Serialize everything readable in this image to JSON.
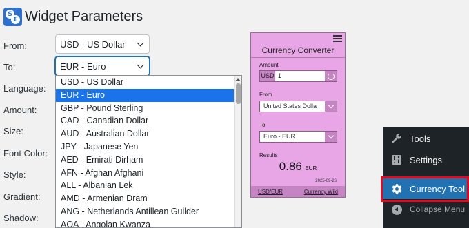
{
  "page": {
    "title": "Widget Parameters",
    "icon_glyphs": [
      "$",
      "£"
    ]
  },
  "form": {
    "labels": {
      "from": "From:",
      "to": "To:",
      "language": "Language:",
      "amount": "Amount:",
      "size": "Size:",
      "font_color": "Font Color:",
      "style": "Style:",
      "gradient": "Gradient:",
      "shadow": "Shadow:"
    },
    "from_value": "USD - US Dollar",
    "to_value": "EUR - Euro"
  },
  "dropdown": {
    "selected_index": 1,
    "options": [
      "USD - US Dollar",
      "EUR - Euro",
      "GBP - Pound Sterling",
      "CAD - Canadian Dollar",
      "AUD - Australian Dollar",
      "JPY - Japanese Yen",
      "AED - Emirati Dirham",
      "AFN - Afghan Afghani",
      "ALL - Albanian Lek",
      "AMD - Armenian Dram",
      "ANG - Netherlands Antillean Guilder",
      "AOA - Angolan Kwanza"
    ]
  },
  "widget": {
    "title": "Currency Converter",
    "amount_label": "Amount",
    "amount_code": "USD",
    "amount_value": "1",
    "from_label": "From",
    "from_value": "United States Dolla",
    "to_label": "To",
    "to_value": "Euro - EUR",
    "results_label": "Results",
    "result_value": "0.86",
    "result_currency": "EUR",
    "date": "2025-09-26",
    "footer_left": "USD/EUR",
    "footer_right": "Currency.Wiki",
    "colors": {
      "background": "#e8a6e6",
      "accent": "#c585c3"
    }
  },
  "admin_menu": {
    "tools": "Tools",
    "settings": "Settings",
    "currency_tool": "Currency Tool",
    "collapse": "Collapse Menu",
    "colors": {
      "background": "#1d2327",
      "current": "#2271b1",
      "highlight": "#e3081b"
    }
  }
}
